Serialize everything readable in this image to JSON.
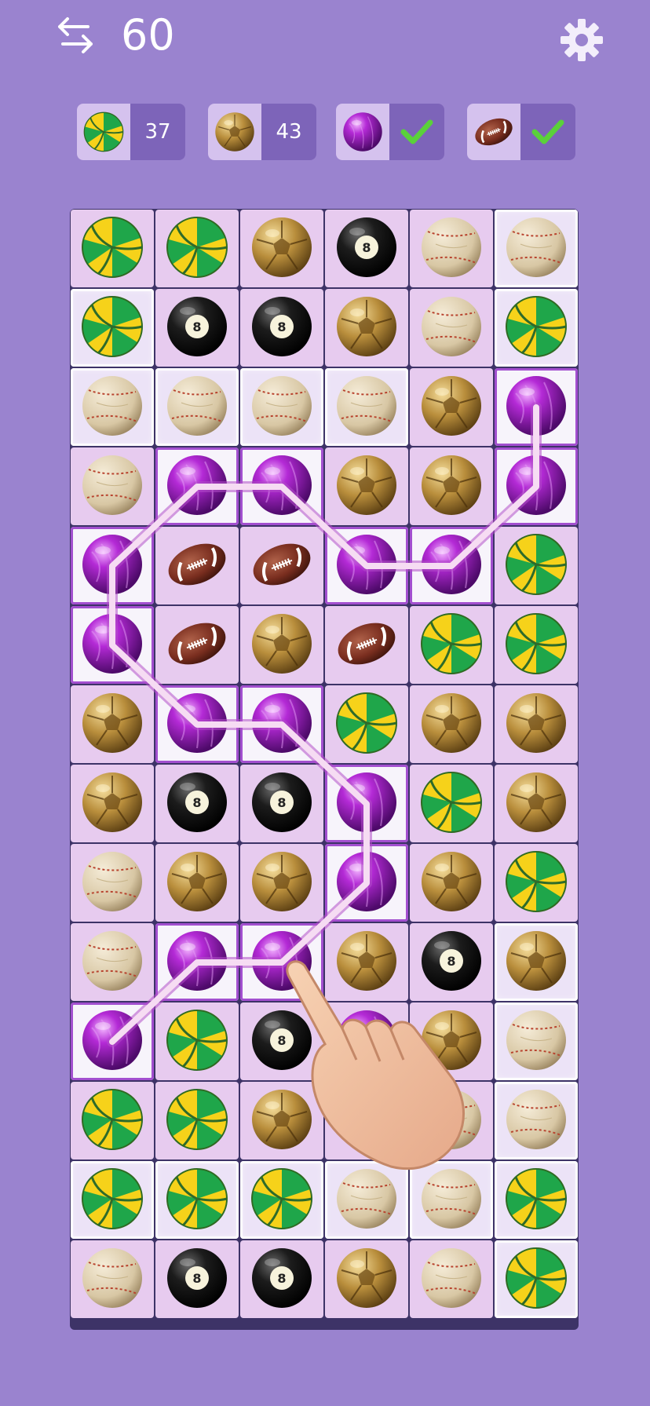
{
  "header": {
    "moves_left": "60",
    "swap_icon": "swap-arrows-icon",
    "settings_icon": "gear-icon"
  },
  "goals": [
    {
      "ball": "volleyball",
      "count": "37",
      "done": false
    },
    {
      "ball": "soccer",
      "count": "43",
      "done": false
    },
    {
      "ball": "bowling",
      "count": "",
      "done": true
    },
    {
      "ball": "football",
      "count": "",
      "done": true
    }
  ],
  "board": {
    "columns": 6,
    "rows": [
      [
        "volleyball",
        "volleyball",
        "soccer",
        "eightball",
        "baseball",
        "baseball"
      ],
      [
        "volleyball",
        "eightball",
        "eightball",
        "soccer",
        "baseball",
        "volleyball"
      ],
      [
        "baseball",
        "baseball",
        "baseball",
        "baseball",
        "soccer",
        "bowling"
      ],
      [
        "baseball",
        "bowling",
        "bowling",
        "soccer",
        "soccer",
        "bowling"
      ],
      [
        "bowling",
        "football",
        "football",
        "bowling",
        "bowling",
        "volleyball"
      ],
      [
        "bowling",
        "football",
        "soccer",
        "football",
        "volleyball",
        "volleyball"
      ],
      [
        "soccer",
        "bowling",
        "bowling",
        "volleyball",
        "soccer",
        "soccer"
      ],
      [
        "soccer",
        "eightball",
        "eightball",
        "bowling",
        "volleyball",
        "soccer"
      ],
      [
        "baseball",
        "soccer",
        "soccer",
        "bowling",
        "soccer",
        "volleyball"
      ],
      [
        "baseball",
        "bowling",
        "bowling",
        "soccer",
        "eightball",
        "soccer"
      ],
      [
        "bowling",
        "volleyball",
        "eightball",
        "bowling",
        "soccer",
        "baseball"
      ],
      [
        "volleyball",
        "volleyball",
        "soccer",
        "eightball",
        "baseball",
        "baseball"
      ],
      [
        "volleyball",
        "volleyball",
        "volleyball",
        "baseball",
        "baseball",
        "volleyball"
      ],
      [
        "baseball",
        "eightball",
        "eightball",
        "soccer",
        "baseball",
        "volleyball"
      ]
    ],
    "frozen_cells": [
      [
        0,
        5
      ],
      [
        1,
        0
      ],
      [
        1,
        5
      ],
      [
        2,
        0
      ],
      [
        2,
        1
      ],
      [
        2,
        2
      ],
      [
        2,
        3
      ],
      [
        9,
        5
      ],
      [
        10,
        5
      ],
      [
        11,
        5
      ],
      [
        12,
        0
      ],
      [
        12,
        1
      ],
      [
        12,
        2
      ],
      [
        12,
        3
      ],
      [
        12,
        4
      ],
      [
        12,
        5
      ],
      [
        13,
        5
      ]
    ],
    "selected_cells": [
      [
        2,
        5
      ],
      [
        3,
        5
      ],
      [
        4,
        4
      ],
      [
        4,
        3
      ],
      [
        3,
        2
      ],
      [
        3,
        1
      ],
      [
        4,
        0
      ],
      [
        5,
        0
      ],
      [
        6,
        1
      ],
      [
        6,
        2
      ],
      [
        7,
        3
      ],
      [
        8,
        3
      ],
      [
        9,
        2
      ],
      [
        9,
        1
      ],
      [
        10,
        0
      ]
    ]
  },
  "colors": {
    "background": "#9a83cf",
    "board_frame": "#3d3367",
    "cell": "#e7cbef",
    "path": "#f6dcf3",
    "check": "#5ad13a"
  },
  "tutorial": {
    "hand_icon": "pointing-hand-icon"
  }
}
